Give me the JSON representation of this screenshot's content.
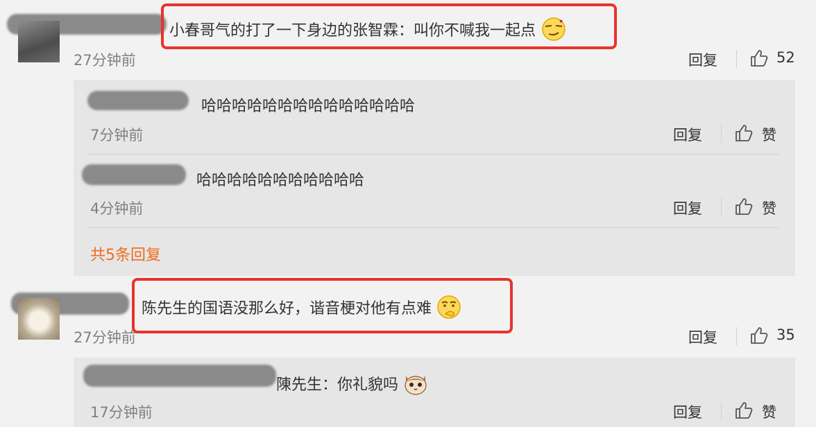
{
  "comments": [
    {
      "text": "小春哥气的打了一下身边的张智霖：叫你不喊我一起点",
      "time": "27分钟前",
      "reply_label": "回复",
      "likes": "52",
      "replies": [
        {
          "text": "哈哈哈哈哈哈哈哈哈哈哈哈哈哈",
          "time": "7分钟前",
          "reply_label": "回复",
          "like_label": "赞"
        },
        {
          "text": "哈哈哈哈哈哈哈哈哈哈哈",
          "time": "4分钟前",
          "reply_label": "回复",
          "like_label": "赞"
        }
      ],
      "more_replies": "共5条回复"
    },
    {
      "text": "陈先生的国语没那么好，谐音梗对他有点难",
      "time": "27分钟前",
      "reply_label": "回复",
      "likes": "35",
      "replies": [
        {
          "text": "陳先生：你礼貌吗",
          "time": "17分钟前",
          "reply_label": "回复",
          "like_label": "赞"
        }
      ]
    }
  ],
  "icons": {
    "like": "thumbs-up-icon",
    "emoji1": "smirk-emoji-icon",
    "emoji2": "thinking-emoji-icon",
    "emoji3": "cat-emoji-icon"
  },
  "colors": {
    "highlight": "#e8322c",
    "accent_orange": "#f26b1b"
  }
}
